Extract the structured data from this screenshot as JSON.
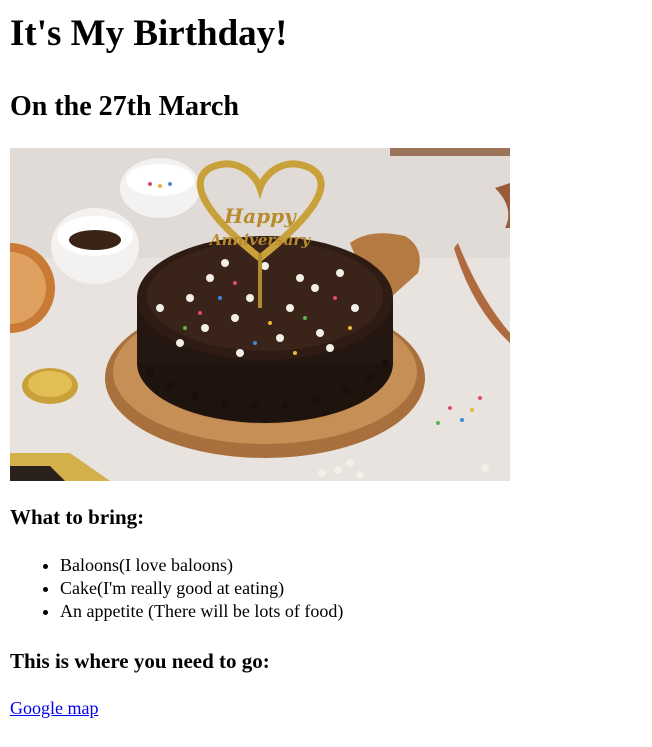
{
  "page": {
    "title": "It's My Birthday!",
    "subtitle": "On the 27th March"
  },
  "image": {
    "topper_line1": "Happy",
    "topper_line2": "Anniversary"
  },
  "bring": {
    "heading": "What to bring:",
    "items": [
      "Baloons(I love baloons)",
      "Cake(I'm really good at eating)",
      "An appetite (There will be lots of food)"
    ]
  },
  "location": {
    "heading": "This is where you need to go:",
    "link_text": "Google map"
  }
}
